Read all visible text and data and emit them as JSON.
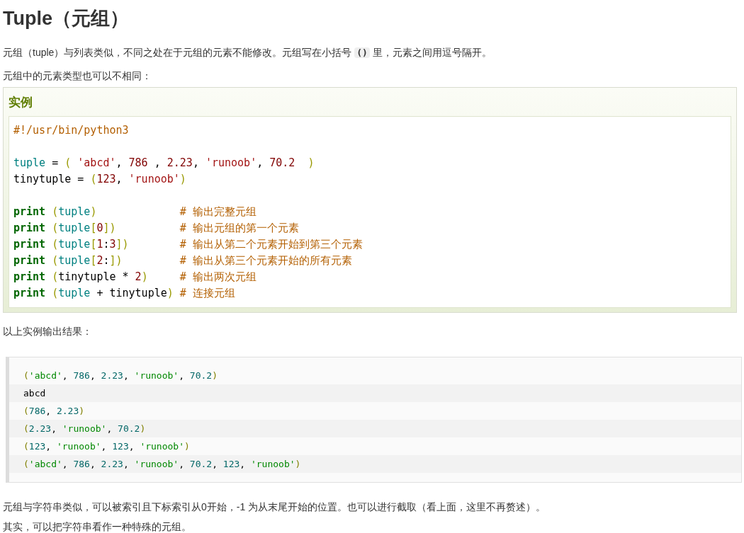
{
  "title": "Tuple（元组）",
  "intro": [
    {
      "kind": "text",
      "text": "元组（tuple）与列表类似，不同之处在于元组的元素不能修改。元组写在小括号 "
    },
    {
      "kind": "code",
      "text": "()"
    },
    {
      "kind": "text",
      "text": " 里，元素之间用逗号隔开。"
    }
  ],
  "intro_2": "元组中的元素类型也可以不相同：",
  "example": {
    "heading": "实例",
    "lines": [
      {
        "kind": "code",
        "tokens": [
          {
            "kind": "comment",
            "text": "#!/usr/bin/python3"
          }
        ]
      },
      {
        "kind": "blank"
      },
      {
        "kind": "code",
        "tokens": [
          {
            "kind": "name",
            "text": "tuple"
          },
          {
            "kind": "plain",
            "text": " = "
          },
          {
            "kind": "punct",
            "text": "( "
          },
          {
            "kind": "string",
            "text": "'abcd'"
          },
          {
            "kind": "plain",
            "text": ", "
          },
          {
            "kind": "number",
            "text": "786"
          },
          {
            "kind": "plain",
            "text": " , "
          },
          {
            "kind": "number",
            "text": "2.23"
          },
          {
            "kind": "plain",
            "text": ", "
          },
          {
            "kind": "string",
            "text": "'runoob'"
          },
          {
            "kind": "plain",
            "text": ", "
          },
          {
            "kind": "number",
            "text": "70.2"
          },
          {
            "kind": "punct",
            "text": "  )"
          }
        ]
      },
      {
        "kind": "code",
        "tokens": [
          {
            "kind": "plain",
            "text": "tinytuple = "
          },
          {
            "kind": "punct",
            "text": "("
          },
          {
            "kind": "number",
            "text": "123"
          },
          {
            "kind": "plain",
            "text": ", "
          },
          {
            "kind": "string",
            "text": "'runoob'"
          },
          {
            "kind": "punct",
            "text": ")"
          }
        ]
      },
      {
        "kind": "blank"
      },
      {
        "kind": "code",
        "tokens": [
          {
            "kind": "keyword",
            "text": "print"
          },
          {
            "kind": "punct",
            "text": " ("
          },
          {
            "kind": "name",
            "text": "tuple"
          },
          {
            "kind": "punct",
            "text": ")"
          },
          {
            "kind": "comment",
            "text": "             # 输出完整元组"
          }
        ]
      },
      {
        "kind": "code",
        "tokens": [
          {
            "kind": "keyword",
            "text": "print"
          },
          {
            "kind": "punct",
            "text": " ("
          },
          {
            "kind": "name",
            "text": "tuple"
          },
          {
            "kind": "punct",
            "text": "["
          },
          {
            "kind": "number",
            "text": "0"
          },
          {
            "kind": "punct",
            "text": "])"
          },
          {
            "kind": "comment",
            "text": "          # 输出元组的第一个元素"
          }
        ]
      },
      {
        "kind": "code",
        "tokens": [
          {
            "kind": "keyword",
            "text": "print"
          },
          {
            "kind": "punct",
            "text": " ("
          },
          {
            "kind": "name",
            "text": "tuple"
          },
          {
            "kind": "punct",
            "text": "["
          },
          {
            "kind": "number",
            "text": "1"
          },
          {
            "kind": "plain",
            "text": ":"
          },
          {
            "kind": "number",
            "text": "3"
          },
          {
            "kind": "punct",
            "text": "])"
          },
          {
            "kind": "comment",
            "text": "        # 输出从第二个元素开始到第三个元素"
          }
        ]
      },
      {
        "kind": "code",
        "tokens": [
          {
            "kind": "keyword",
            "text": "print"
          },
          {
            "kind": "punct",
            "text": " ("
          },
          {
            "kind": "name",
            "text": "tuple"
          },
          {
            "kind": "punct",
            "text": "["
          },
          {
            "kind": "number",
            "text": "2"
          },
          {
            "kind": "plain",
            "text": ":"
          },
          {
            "kind": "punct",
            "text": "])"
          },
          {
            "kind": "comment",
            "text": "         # 输出从第三个元素开始的所有元素"
          }
        ]
      },
      {
        "kind": "code",
        "tokens": [
          {
            "kind": "keyword",
            "text": "print"
          },
          {
            "kind": "punct",
            "text": " ("
          },
          {
            "kind": "plain",
            "text": "tinytuple * "
          },
          {
            "kind": "number",
            "text": "2"
          },
          {
            "kind": "punct",
            "text": ")"
          },
          {
            "kind": "comment",
            "text": "     # 输出两次元组"
          }
        ]
      },
      {
        "kind": "code",
        "tokens": [
          {
            "kind": "keyword",
            "text": "print"
          },
          {
            "kind": "punct",
            "text": " ("
          },
          {
            "kind": "name",
            "text": "tuple"
          },
          {
            "kind": "plain",
            "text": " + tinytuple"
          },
          {
            "kind": "punct",
            "text": ")"
          },
          {
            "kind": "comment",
            "text": " # 连接元组"
          }
        ]
      }
    ]
  },
  "output_label": "以上实例输出结果：",
  "output_lines": [
    [
      {
        "kind": "punct",
        "text": "("
      },
      {
        "kind": "string",
        "text": "'abcd'"
      },
      {
        "kind": "plain",
        "text": ", "
      },
      {
        "kind": "number",
        "text": "786"
      },
      {
        "kind": "plain",
        "text": ", "
      },
      {
        "kind": "number",
        "text": "2.23"
      },
      {
        "kind": "plain",
        "text": ", "
      },
      {
        "kind": "string",
        "text": "'runoob'"
      },
      {
        "kind": "plain",
        "text": ", "
      },
      {
        "kind": "number",
        "text": "70.2"
      },
      {
        "kind": "punct",
        "text": ")"
      }
    ],
    [
      {
        "kind": "plain",
        "text": "abcd"
      }
    ],
    [
      {
        "kind": "punct",
        "text": "("
      },
      {
        "kind": "number",
        "text": "786"
      },
      {
        "kind": "plain",
        "text": ", "
      },
      {
        "kind": "number",
        "text": "2.23"
      },
      {
        "kind": "punct",
        "text": ")"
      }
    ],
    [
      {
        "kind": "punct",
        "text": "("
      },
      {
        "kind": "number",
        "text": "2.23"
      },
      {
        "kind": "plain",
        "text": ", "
      },
      {
        "kind": "string",
        "text": "'runoob'"
      },
      {
        "kind": "plain",
        "text": ", "
      },
      {
        "kind": "number",
        "text": "70.2"
      },
      {
        "kind": "punct",
        "text": ")"
      }
    ],
    [
      {
        "kind": "punct",
        "text": "("
      },
      {
        "kind": "number",
        "text": "123"
      },
      {
        "kind": "plain",
        "text": ", "
      },
      {
        "kind": "string",
        "text": "'runoob'"
      },
      {
        "kind": "plain",
        "text": ", "
      },
      {
        "kind": "number",
        "text": "123"
      },
      {
        "kind": "plain",
        "text": ", "
      },
      {
        "kind": "string",
        "text": "'runoob'"
      },
      {
        "kind": "punct",
        "text": ")"
      }
    ],
    [
      {
        "kind": "punct",
        "text": "("
      },
      {
        "kind": "string",
        "text": "'abcd'"
      },
      {
        "kind": "plain",
        "text": ", "
      },
      {
        "kind": "number",
        "text": "786"
      },
      {
        "kind": "plain",
        "text": ", "
      },
      {
        "kind": "number",
        "text": "2.23"
      },
      {
        "kind": "plain",
        "text": ", "
      },
      {
        "kind": "string",
        "text": "'runoob'"
      },
      {
        "kind": "plain",
        "text": ", "
      },
      {
        "kind": "number",
        "text": "70.2"
      },
      {
        "kind": "plain",
        "text": ", "
      },
      {
        "kind": "number",
        "text": "123"
      },
      {
        "kind": "plain",
        "text": ", "
      },
      {
        "kind": "string",
        "text": "'runoob'"
      },
      {
        "kind": "punct",
        "text": ")"
      }
    ]
  ],
  "paragraphs": [
    "元组与字符串类似，可以被索引且下标索引从0开始，-1 为从末尾开始的位置。也可以进行截取（看上面，这里不再赘述）。",
    "其实，可以把字符串看作一种特殊的元组。"
  ]
}
